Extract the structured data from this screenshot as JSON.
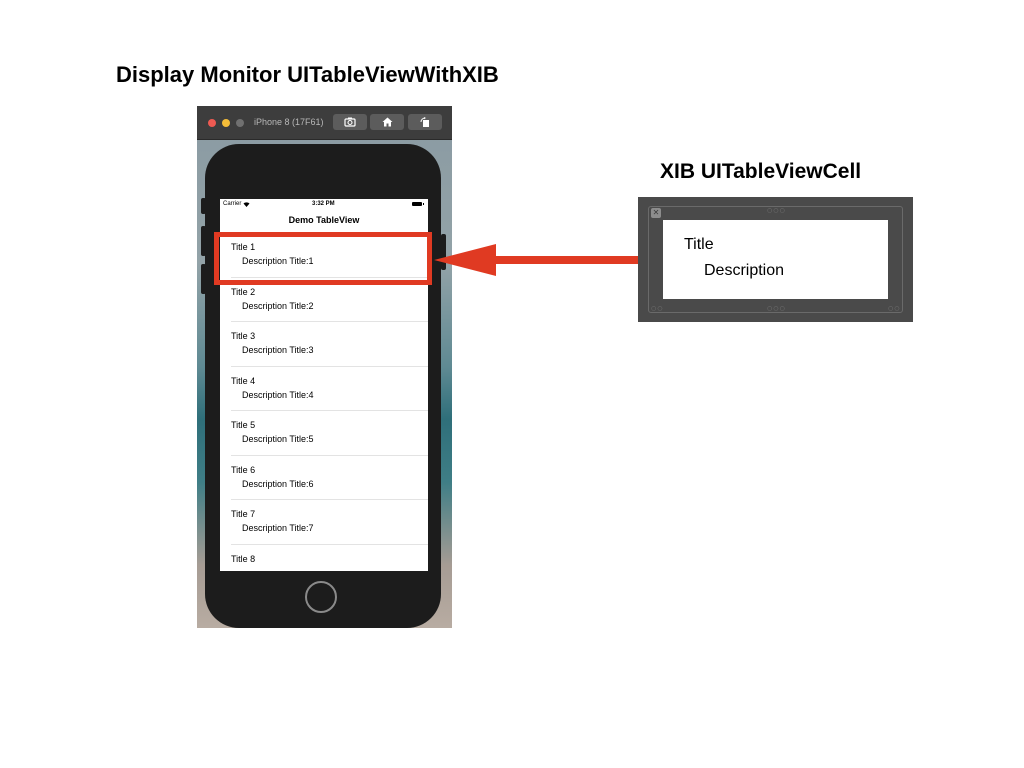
{
  "slide": {
    "title": "Display Monitor UITableViewWithXIB"
  },
  "simulator": {
    "window_title": "iPhone 8 (17F61)",
    "toolbar_icons": [
      "screenshot-icon",
      "home-icon",
      "rotate-icon"
    ]
  },
  "status_bar": {
    "carrier": "Carrier",
    "time": "3:32 PM"
  },
  "nav": {
    "title": "Demo TableView"
  },
  "table": {
    "rows": [
      {
        "title": "Title 1",
        "description": "Description Title:1"
      },
      {
        "title": "Title 2",
        "description": "Description Title:2"
      },
      {
        "title": "Title 3",
        "description": "Description Title:3"
      },
      {
        "title": "Title 4",
        "description": "Description Title:4"
      },
      {
        "title": "Title 5",
        "description": "Description Title:5"
      },
      {
        "title": "Title 6",
        "description": "Description Title:6"
      },
      {
        "title": "Title 7",
        "description": "Description Title:7"
      },
      {
        "title": "Title 8",
        "description": ""
      }
    ]
  },
  "xib": {
    "heading": "XIB UITableViewCell",
    "cell_title": "Title",
    "cell_description": "Description"
  },
  "colors": {
    "highlight": "#e03a22",
    "xib_background": "#4a4a4a"
  }
}
